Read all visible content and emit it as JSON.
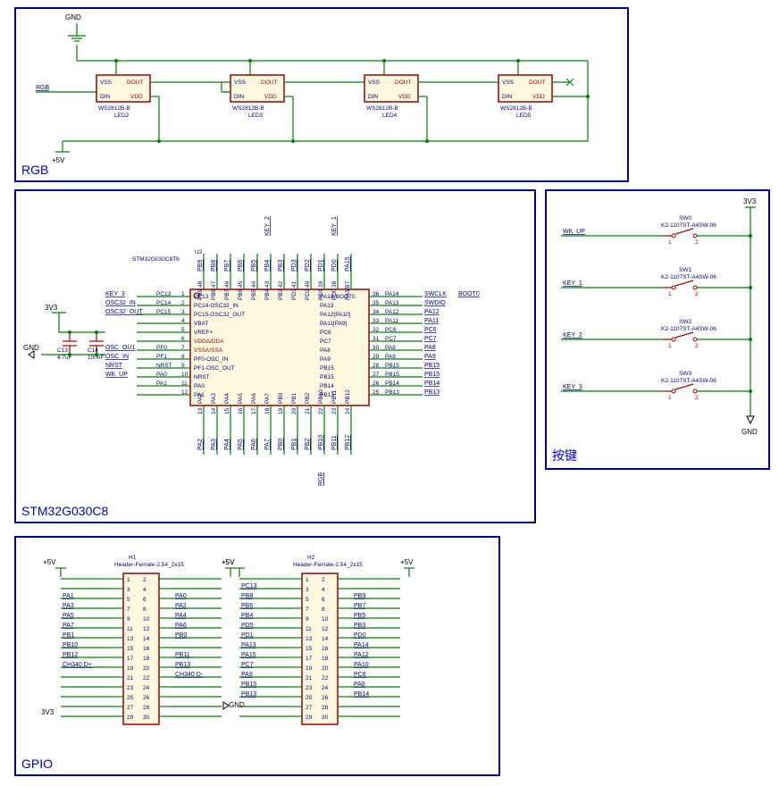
{
  "blocks": {
    "rgb": {
      "title": "RGB",
      "gnd": "GND",
      "v5": "+5V",
      "netlabel": "RGB",
      "leds": [
        {
          "ref": "LED2",
          "part": "WS2812B-B"
        },
        {
          "ref": "LED3",
          "part": "WS2812B-B"
        },
        {
          "ref": "LED4",
          "part": "WS2812B-B"
        },
        {
          "ref": "LED5",
          "part": "WS2812B-B"
        }
      ],
      "pins": {
        "vss": "VSS",
        "din": "DIN",
        "dout": "DOUT",
        "vdd": "VDD"
      }
    },
    "mcu": {
      "title": "STM32G030C8",
      "ref": "U2",
      "part": "STM32G030C8T6",
      "pwr3v3": "3V3",
      "gnd": "GND",
      "caps": [
        {
          "ref": "C13",
          "val": "4.7uF"
        },
        {
          "ref": "C14",
          "val": "100nF"
        }
      ],
      "topNets": [
        "PB9",
        "PB8",
        "PB7",
        "PB6",
        "PB5",
        "PB4",
        "PB3",
        "PD3",
        "PD2",
        "PD1",
        "PD0",
        "PA15"
      ],
      "topExtraNets": {
        "key2": "KEY_2",
        "key1": "KEY_1"
      },
      "leftNets": [
        "KEY_3",
        "OSC32_IN",
        "OSC32_OUT",
        "",
        "",
        "",
        "OSC_OU1",
        "OSC_IN",
        "NRST",
        "WK_UP",
        ""
      ],
      "leftPinLabels": [
        "PC13",
        "PC14",
        "PC15",
        "",
        "",
        "",
        "PF0",
        "PF1",
        "NRST",
        "PA0",
        "PA1"
      ],
      "leftPinNums": [
        "1",
        "2",
        "3",
        "4",
        "5",
        "6",
        "7",
        "8",
        "9",
        "10",
        "11",
        "12"
      ],
      "leftInside": [
        "PC13",
        "PC14-OSC32_IN",
        "PC15-OSC32_OUT",
        "VBAT",
        "VREF+",
        "VDDA/DDA",
        "VSSA/SSA",
        "PF0-OSC_IN",
        "PF1-OSC_OUT",
        "NRST",
        "PA0",
        "PA1"
      ],
      "rightInside": [
        "PA14-BOOT0",
        "PA13",
        "PA12[PA10]",
        "PA11[PA9]",
        "PC6",
        "PC7",
        "PA8",
        "PA9",
        "PB15",
        "PB15",
        "PB14",
        "PB13"
      ],
      "rightPinNums": [
        "36",
        "35",
        "34",
        "33",
        "32",
        "31",
        "30",
        "29",
        "28",
        "27",
        "26",
        "25"
      ],
      "rightPinLabels": [
        "PA14",
        "PA13",
        "PA12",
        "PA11",
        "PC6",
        "PC7",
        "PA8",
        "PA9",
        "PB15",
        "PB15",
        "PB14",
        "PB13"
      ],
      "rightNets": [
        "SWCLK",
        "SWDIO",
        "PA12",
        "PA11",
        "PC6",
        "PC7",
        "PA8",
        "PA9",
        "PB15",
        "PB15",
        "PB14",
        "PB13"
      ],
      "rightExtra": "BOOT0",
      "botPinNums": [
        "13",
        "14",
        "15",
        "16",
        "17",
        "18",
        "19",
        "20",
        "21",
        "22",
        "23",
        "24"
      ],
      "botInside": [
        "PA2",
        "PA3",
        "PA4",
        "PA5",
        "PA6",
        "PA7",
        "PB0",
        "PB1",
        "PB2",
        "PB10",
        "PB11",
        "PB12"
      ],
      "botNets": [
        "PA2",
        "PA3",
        "PA4",
        "PA5",
        "PA6",
        "PA7",
        "PB0",
        "PB1",
        "PB2",
        "PB10",
        "PB11",
        "PB12"
      ],
      "botExtra": "RGB"
    },
    "keys": {
      "title": "按键",
      "v3": "3V3",
      "gnd": "GND",
      "switches": [
        {
          "ref": "SW0",
          "part": "K2-1107ST-A4SW-06",
          "net": "WK_UP"
        },
        {
          "ref": "SW1",
          "part": "K2-1107ST-A4SW-06",
          "net": "KEY_1"
        },
        {
          "ref": "SW2",
          "part": "K2-1107ST-A4SW-06",
          "net": "KEY_2"
        },
        {
          "ref": "SW3",
          "part": "K2-1107ST-A4SW-06",
          "net": "KEY_3"
        }
      ],
      "pin1": "1",
      "pin2": "2"
    },
    "gpio": {
      "title": "GPIO",
      "headers": [
        {
          "ref": "H1",
          "part": "Header-Female-2.54_2x15",
          "v5": "+5V",
          "v3": "3V3",
          "gnd": "GND",
          "leftNets": [
            "",
            "",
            "PA1",
            "PA3",
            "PA5",
            "PA7",
            "PB1",
            "PB10",
            "PB12",
            "CH340 D+",
            "",
            "",
            "",
            ""
          ],
          "rightNets": [
            "",
            "",
            "PA0",
            "PA2",
            "PA4",
            "PA6",
            "PB0",
            "",
            "PB11",
            "PB13",
            "CH340 D-",
            "",
            "",
            ""
          ]
        },
        {
          "ref": "H2",
          "part": "Header-Female-2.54_2x15",
          "v5": "+5V",
          "v3": "3V3",
          "gnd": "GND",
          "leftNets": [
            "",
            "PC13",
            "PB8",
            "PB6",
            "PB4",
            "PD5",
            "PD1",
            "PA13",
            "PA15",
            "PC7",
            "PA9",
            "PB15",
            "PB13",
            ""
          ],
          "rightNets": [
            "",
            "",
            "PB9",
            "PB7",
            "PB5",
            "PB3",
            "PD0",
            "PA14",
            "PA12",
            "PA10",
            "PC6",
            "PA8",
            "PB14",
            ""
          ]
        }
      ],
      "pinRows": [
        [
          "1",
          "2"
        ],
        [
          "3",
          "4"
        ],
        [
          "5",
          "6"
        ],
        [
          "7",
          "8"
        ],
        [
          "9",
          "10"
        ],
        [
          "11",
          "12"
        ],
        [
          "13",
          "14"
        ],
        [
          "15",
          "16"
        ],
        [
          "17",
          "18"
        ],
        [
          "19",
          "20"
        ],
        [
          "21",
          "22"
        ],
        [
          "23",
          "24"
        ],
        [
          "25",
          "26"
        ],
        [
          "27",
          "28"
        ],
        [
          "29",
          "30"
        ]
      ]
    }
  }
}
